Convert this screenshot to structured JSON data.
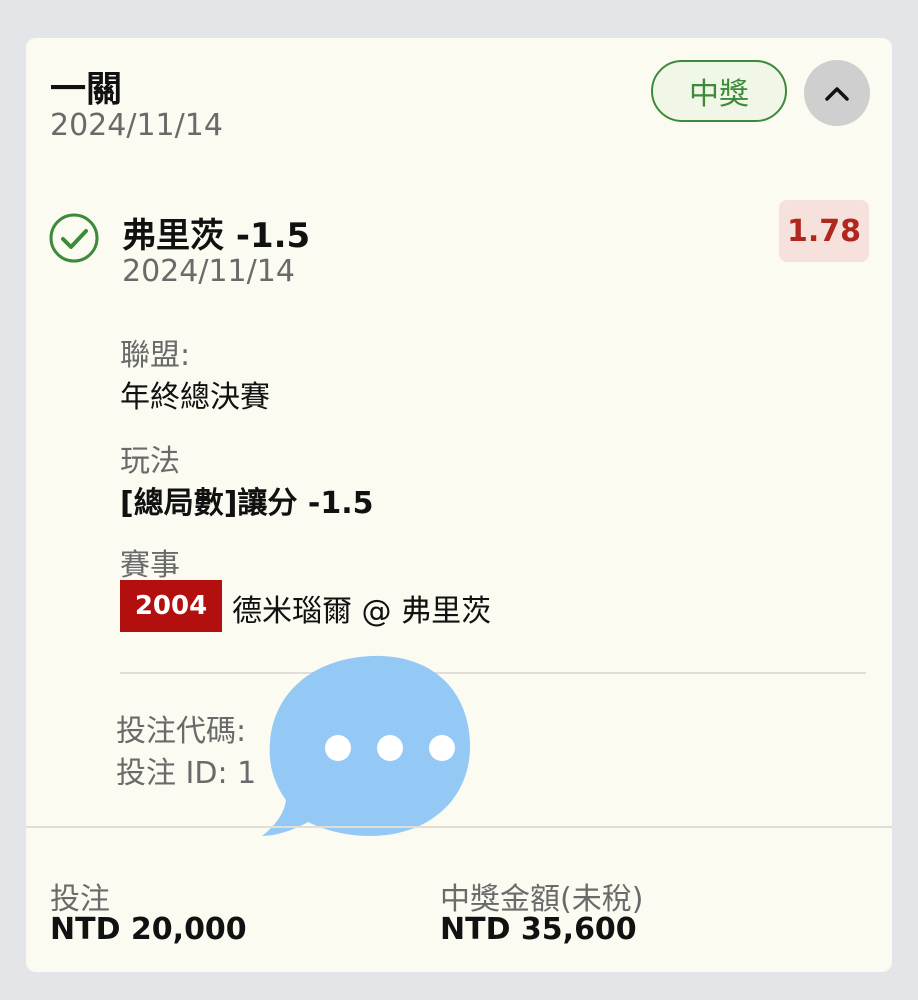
{
  "header": {
    "title": "一關",
    "date": "2024/11/14",
    "status_badge": "中獎",
    "collapse_icon": "chevron-up-icon"
  },
  "selection": {
    "status_icon": "check-circle-icon",
    "name": "弗里茨 -1.5",
    "date": "2024/11/14",
    "odds": "1.78"
  },
  "details": {
    "league_label": "聯盟:",
    "league_value": "年終總決賽",
    "play_label": "玩法",
    "play_value": "[總局數]讓分 -1.5",
    "match_label": "賽事",
    "match_code": "2004",
    "match_name": "德米瑙爾 @ 弗里茨"
  },
  "meta": {
    "bet_code_label": "投注代碼:",
    "bet_id_label": "投注 ID: 1"
  },
  "overlay": {
    "icon": "chat-bubble-icon"
  },
  "summary": {
    "stake_label": "投注",
    "stake_value": "NTD 20,000",
    "payout_label": "中獎金額(未稅)",
    "payout_value": "NTD 35,600"
  },
  "colors": {
    "card_bg": "#fcfbf2",
    "win_green": "#3d8a3a",
    "odds_red": "#b1261d",
    "event_code_bg": "#b30f0f",
    "bubble_blue": "#94c9f6"
  }
}
